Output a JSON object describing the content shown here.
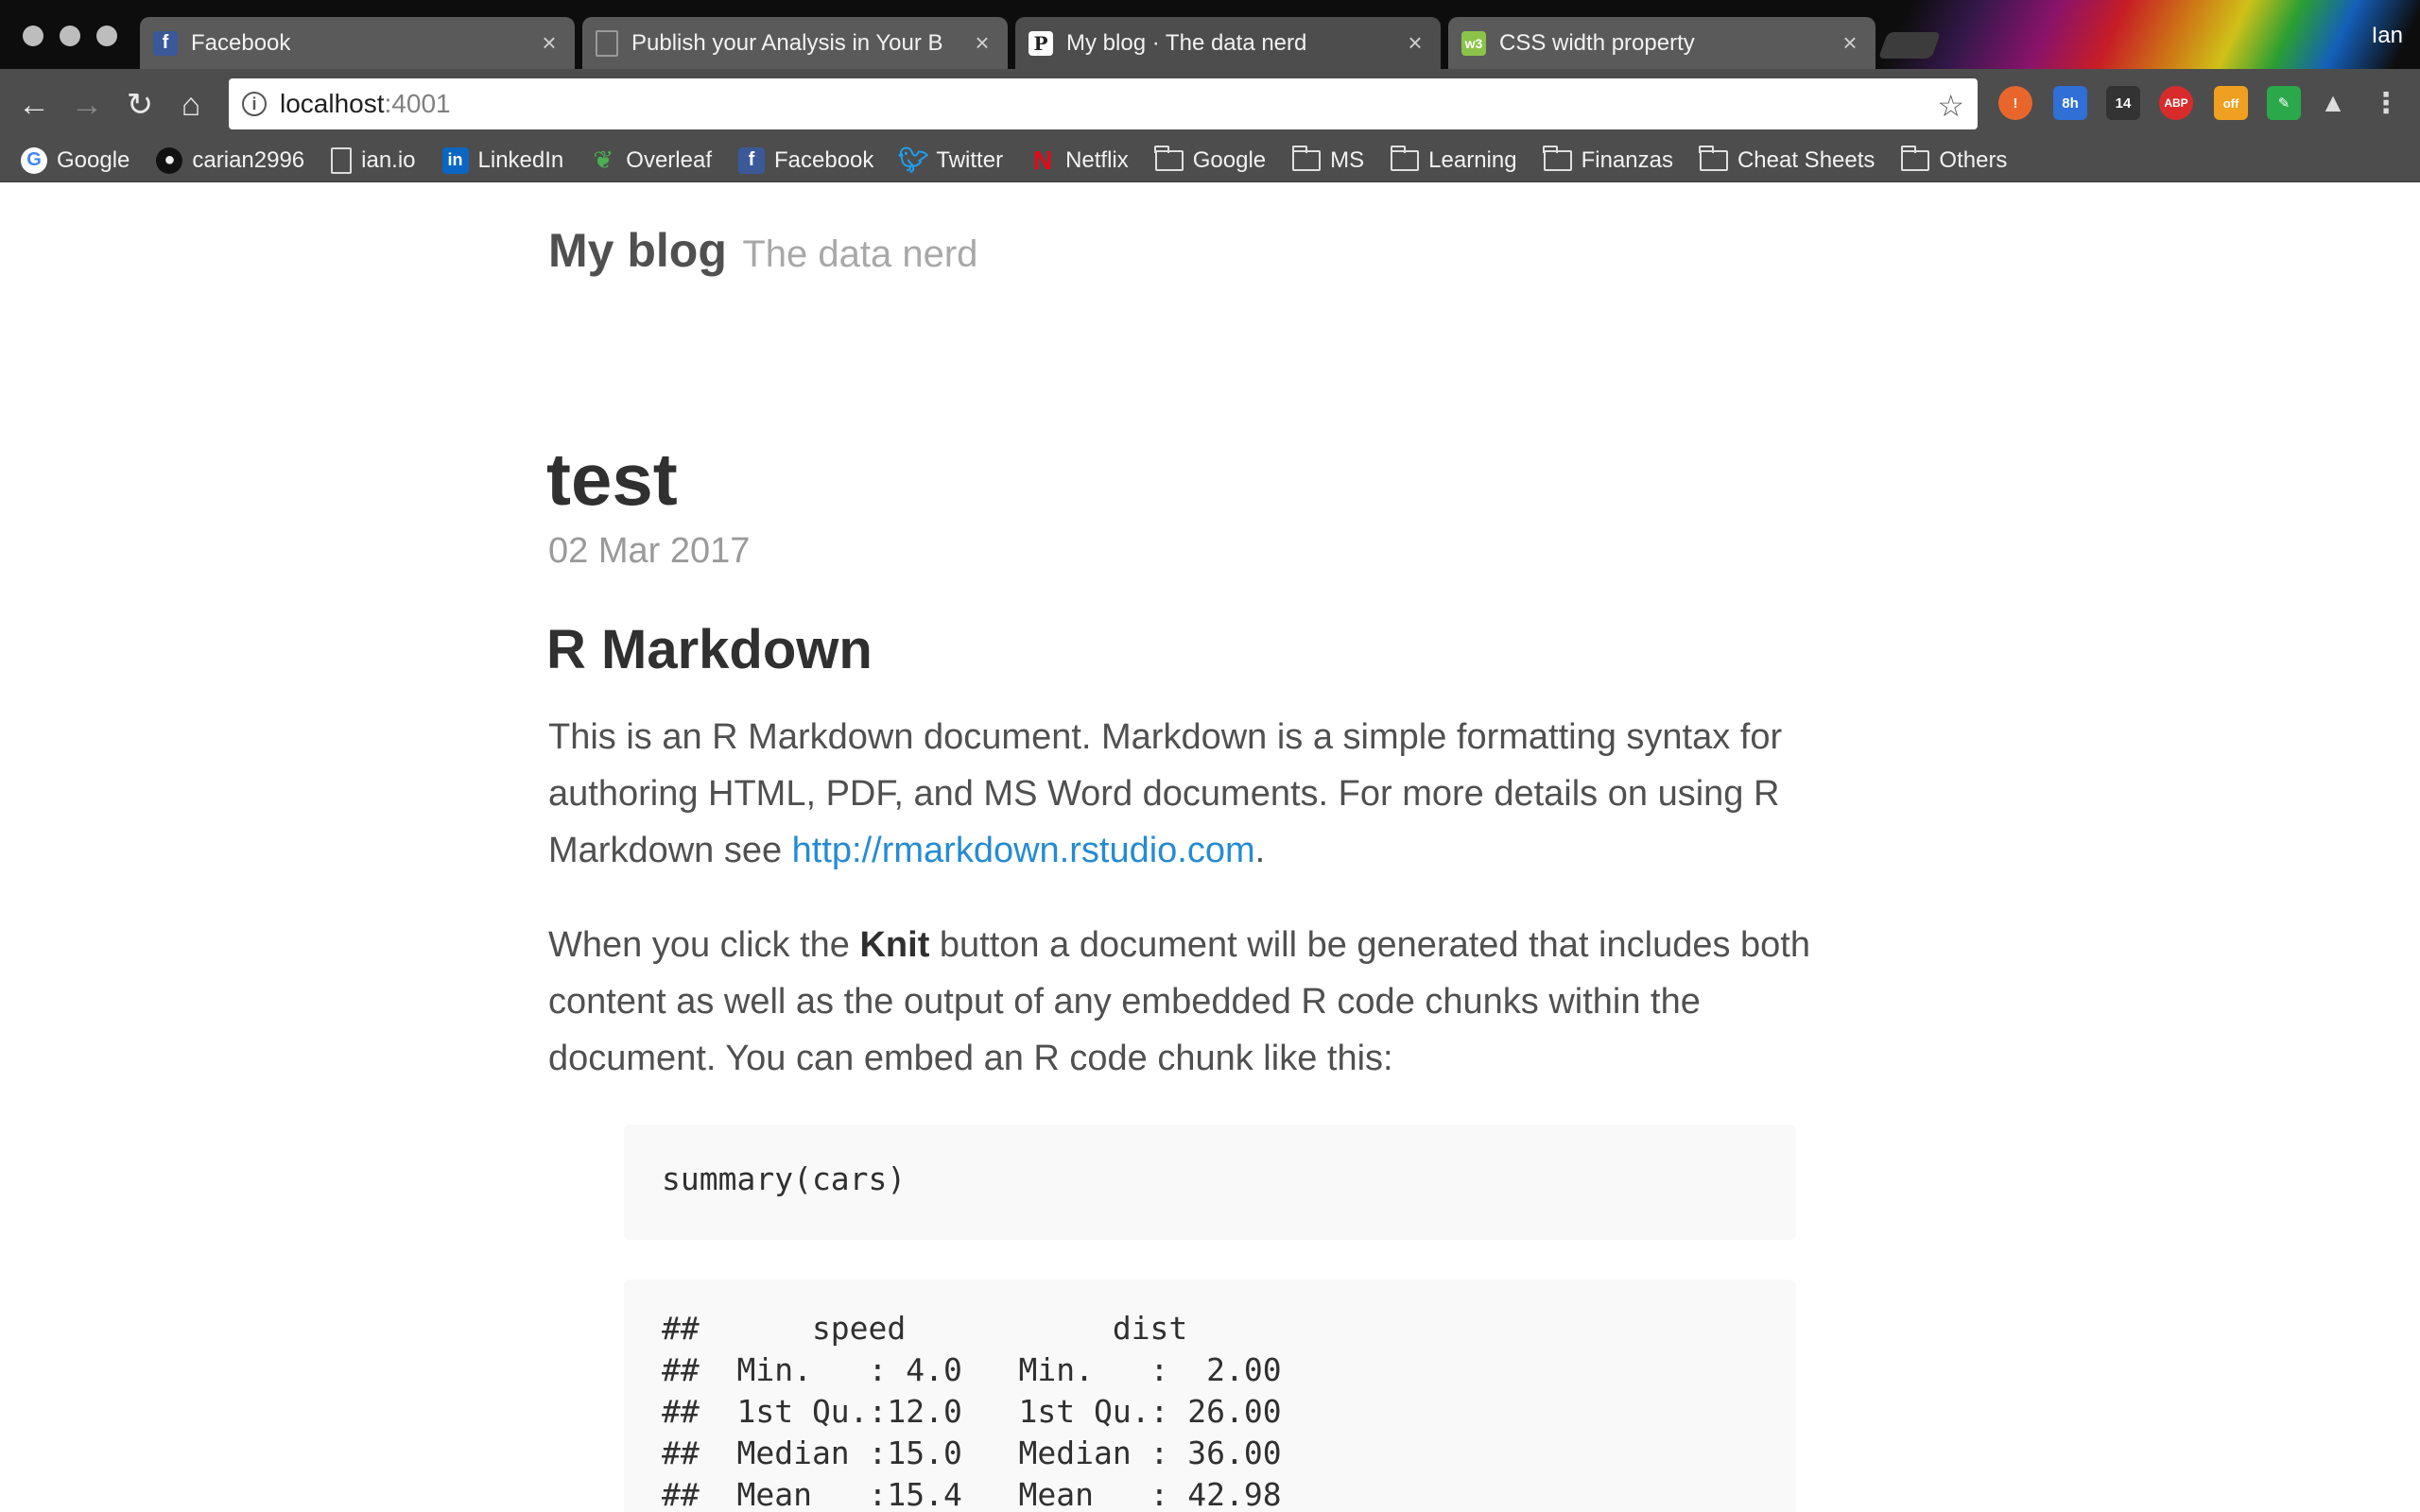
{
  "window": {
    "profile_name": "Ian"
  },
  "tabs": [
    {
      "title": "Facebook",
      "active": false
    },
    {
      "title": "Publish your Analysis in Your B",
      "active": false
    },
    {
      "title": "My blog · The data nerd",
      "active": true
    },
    {
      "title": "CSS width property",
      "active": false
    }
  ],
  "omnibox": {
    "host": "localhost",
    "port": ":4001"
  },
  "extensions": {
    "calendar_badge": "8h",
    "weather_badge": "14",
    "adblock_label": "ABP",
    "off_label": "off"
  },
  "bookmarks": [
    {
      "label": "Google",
      "icon": "google-icon"
    },
    {
      "label": "carian2996",
      "icon": "github-icon"
    },
    {
      "label": "ian.io",
      "icon": "page-icon"
    },
    {
      "label": "LinkedIn",
      "icon": "linkedin-icon"
    },
    {
      "label": "Overleaf",
      "icon": "overleaf-icon"
    },
    {
      "label": "Facebook",
      "icon": "facebook-icon"
    },
    {
      "label": "Twitter",
      "icon": "twitter-icon"
    },
    {
      "label": "Netflix",
      "icon": "netflix-icon"
    },
    {
      "label": "Google",
      "icon": "folder-icon"
    },
    {
      "label": "MS",
      "icon": "folder-icon"
    },
    {
      "label": "Learning",
      "icon": "folder-icon"
    },
    {
      "label": "Finanzas",
      "icon": "folder-icon"
    },
    {
      "label": "Cheat Sheets",
      "icon": "folder-icon"
    },
    {
      "label": "Others",
      "icon": "folder-icon"
    }
  ],
  "blog": {
    "site_title": "My blog",
    "tagline": "The data nerd",
    "post_title": "test",
    "post_date": "02 Mar 2017",
    "heading": "R Markdown",
    "para1_text": "This is an R Markdown document. Markdown is a simple formatting syntax for authoring HTML, PDF, and MS Word documents. For more details on using R Markdown see ",
    "para1_link": "http://rmarkdown.rstudio.com",
    "para1_end": ".",
    "para2_before": "When you click the ",
    "para2_bold": "Knit",
    "para2_after": " button a document will be generated that includes both content as well as the output of any embedded R code chunks within the document. You can embed an R code chunk like this:",
    "code_chunk": "summary(cars)",
    "output_lines": [
      "##      speed           dist       ",
      "##  Min.   : 4.0   Min.   :  2.00  ",
      "##  1st Qu.:12.0   1st Qu.: 26.00  ",
      "##  Median :15.0   Median : 36.00  ",
      "##  Mean   :15.4   Mean   : 42.98  "
    ]
  },
  "colors": {
    "link": "#268bd2",
    "chrome_dark": "#4d4d4d"
  }
}
